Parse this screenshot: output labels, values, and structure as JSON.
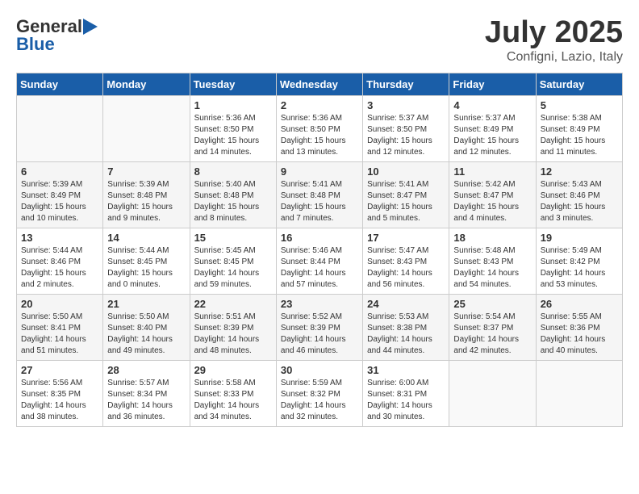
{
  "header": {
    "logo_general": "General",
    "logo_blue": "Blue",
    "month_title": "July 2025",
    "subtitle": "Configni, Lazio, Italy"
  },
  "days_of_week": [
    "Sunday",
    "Monday",
    "Tuesday",
    "Wednesday",
    "Thursday",
    "Friday",
    "Saturday"
  ],
  "weeks": [
    [
      {
        "day": "",
        "sunrise": "",
        "sunset": "",
        "daylight": ""
      },
      {
        "day": "",
        "sunrise": "",
        "sunset": "",
        "daylight": ""
      },
      {
        "day": "1",
        "sunrise": "Sunrise: 5:36 AM",
        "sunset": "Sunset: 8:50 PM",
        "daylight": "Daylight: 15 hours and 14 minutes."
      },
      {
        "day": "2",
        "sunrise": "Sunrise: 5:36 AM",
        "sunset": "Sunset: 8:50 PM",
        "daylight": "Daylight: 15 hours and 13 minutes."
      },
      {
        "day": "3",
        "sunrise": "Sunrise: 5:37 AM",
        "sunset": "Sunset: 8:50 PM",
        "daylight": "Daylight: 15 hours and 12 minutes."
      },
      {
        "day": "4",
        "sunrise": "Sunrise: 5:37 AM",
        "sunset": "Sunset: 8:49 PM",
        "daylight": "Daylight: 15 hours and 12 minutes."
      },
      {
        "day": "5",
        "sunrise": "Sunrise: 5:38 AM",
        "sunset": "Sunset: 8:49 PM",
        "daylight": "Daylight: 15 hours and 11 minutes."
      }
    ],
    [
      {
        "day": "6",
        "sunrise": "Sunrise: 5:39 AM",
        "sunset": "Sunset: 8:49 PM",
        "daylight": "Daylight: 15 hours and 10 minutes."
      },
      {
        "day": "7",
        "sunrise": "Sunrise: 5:39 AM",
        "sunset": "Sunset: 8:48 PM",
        "daylight": "Daylight: 15 hours and 9 minutes."
      },
      {
        "day": "8",
        "sunrise": "Sunrise: 5:40 AM",
        "sunset": "Sunset: 8:48 PM",
        "daylight": "Daylight: 15 hours and 8 minutes."
      },
      {
        "day": "9",
        "sunrise": "Sunrise: 5:41 AM",
        "sunset": "Sunset: 8:48 PM",
        "daylight": "Daylight: 15 hours and 7 minutes."
      },
      {
        "day": "10",
        "sunrise": "Sunrise: 5:41 AM",
        "sunset": "Sunset: 8:47 PM",
        "daylight": "Daylight: 15 hours and 5 minutes."
      },
      {
        "day": "11",
        "sunrise": "Sunrise: 5:42 AM",
        "sunset": "Sunset: 8:47 PM",
        "daylight": "Daylight: 15 hours and 4 minutes."
      },
      {
        "day": "12",
        "sunrise": "Sunrise: 5:43 AM",
        "sunset": "Sunset: 8:46 PM",
        "daylight": "Daylight: 15 hours and 3 minutes."
      }
    ],
    [
      {
        "day": "13",
        "sunrise": "Sunrise: 5:44 AM",
        "sunset": "Sunset: 8:46 PM",
        "daylight": "Daylight: 15 hours and 2 minutes."
      },
      {
        "day": "14",
        "sunrise": "Sunrise: 5:44 AM",
        "sunset": "Sunset: 8:45 PM",
        "daylight": "Daylight: 15 hours and 0 minutes."
      },
      {
        "day": "15",
        "sunrise": "Sunrise: 5:45 AM",
        "sunset": "Sunset: 8:45 PM",
        "daylight": "Daylight: 14 hours and 59 minutes."
      },
      {
        "day": "16",
        "sunrise": "Sunrise: 5:46 AM",
        "sunset": "Sunset: 8:44 PM",
        "daylight": "Daylight: 14 hours and 57 minutes."
      },
      {
        "day": "17",
        "sunrise": "Sunrise: 5:47 AM",
        "sunset": "Sunset: 8:43 PM",
        "daylight": "Daylight: 14 hours and 56 minutes."
      },
      {
        "day": "18",
        "sunrise": "Sunrise: 5:48 AM",
        "sunset": "Sunset: 8:43 PM",
        "daylight": "Daylight: 14 hours and 54 minutes."
      },
      {
        "day": "19",
        "sunrise": "Sunrise: 5:49 AM",
        "sunset": "Sunset: 8:42 PM",
        "daylight": "Daylight: 14 hours and 53 minutes."
      }
    ],
    [
      {
        "day": "20",
        "sunrise": "Sunrise: 5:50 AM",
        "sunset": "Sunset: 8:41 PM",
        "daylight": "Daylight: 14 hours and 51 minutes."
      },
      {
        "day": "21",
        "sunrise": "Sunrise: 5:50 AM",
        "sunset": "Sunset: 8:40 PM",
        "daylight": "Daylight: 14 hours and 49 minutes."
      },
      {
        "day": "22",
        "sunrise": "Sunrise: 5:51 AM",
        "sunset": "Sunset: 8:39 PM",
        "daylight": "Daylight: 14 hours and 48 minutes."
      },
      {
        "day": "23",
        "sunrise": "Sunrise: 5:52 AM",
        "sunset": "Sunset: 8:39 PM",
        "daylight": "Daylight: 14 hours and 46 minutes."
      },
      {
        "day": "24",
        "sunrise": "Sunrise: 5:53 AM",
        "sunset": "Sunset: 8:38 PM",
        "daylight": "Daylight: 14 hours and 44 minutes."
      },
      {
        "day": "25",
        "sunrise": "Sunrise: 5:54 AM",
        "sunset": "Sunset: 8:37 PM",
        "daylight": "Daylight: 14 hours and 42 minutes."
      },
      {
        "day": "26",
        "sunrise": "Sunrise: 5:55 AM",
        "sunset": "Sunset: 8:36 PM",
        "daylight": "Daylight: 14 hours and 40 minutes."
      }
    ],
    [
      {
        "day": "27",
        "sunrise": "Sunrise: 5:56 AM",
        "sunset": "Sunset: 8:35 PM",
        "daylight": "Daylight: 14 hours and 38 minutes."
      },
      {
        "day": "28",
        "sunrise": "Sunrise: 5:57 AM",
        "sunset": "Sunset: 8:34 PM",
        "daylight": "Daylight: 14 hours and 36 minutes."
      },
      {
        "day": "29",
        "sunrise": "Sunrise: 5:58 AM",
        "sunset": "Sunset: 8:33 PM",
        "daylight": "Daylight: 14 hours and 34 minutes."
      },
      {
        "day": "30",
        "sunrise": "Sunrise: 5:59 AM",
        "sunset": "Sunset: 8:32 PM",
        "daylight": "Daylight: 14 hours and 32 minutes."
      },
      {
        "day": "31",
        "sunrise": "Sunrise: 6:00 AM",
        "sunset": "Sunset: 8:31 PM",
        "daylight": "Daylight: 14 hours and 30 minutes."
      },
      {
        "day": "",
        "sunrise": "",
        "sunset": "",
        "daylight": ""
      },
      {
        "day": "",
        "sunrise": "",
        "sunset": "",
        "daylight": ""
      }
    ]
  ]
}
